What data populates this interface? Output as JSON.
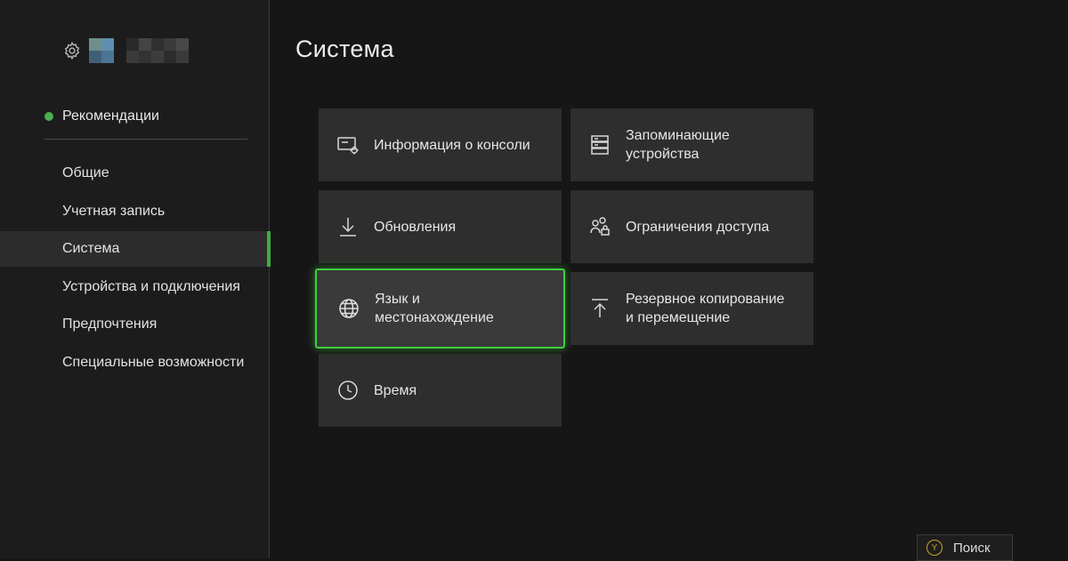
{
  "page": {
    "title": "Система"
  },
  "sidebar": {
    "recommendations": "Рекомендации",
    "items": [
      {
        "label": "Общие"
      },
      {
        "label": "Учетная запись"
      },
      {
        "label": "Система"
      },
      {
        "label": "Устройства и подключения"
      },
      {
        "label": "Предпочтения"
      },
      {
        "label": "Специальные возможности"
      }
    ]
  },
  "tiles": {
    "console_info": "Информация о консоли",
    "storage_line1": "Запоминающие",
    "storage_line2": "устройства",
    "updates": "Обновления",
    "access": "Ограничения доступа",
    "language_line1": "Язык и",
    "language_line2": "местонахождение",
    "backup_line1": "Резервное копирование",
    "backup_line2": "и перемещение",
    "time": "Время"
  },
  "footer": {
    "search_button": "Y",
    "search_label": "Поиск"
  },
  "colors": {
    "accent": "#3fcf3f",
    "background": "#161616",
    "tile": "#2e2e2e"
  }
}
